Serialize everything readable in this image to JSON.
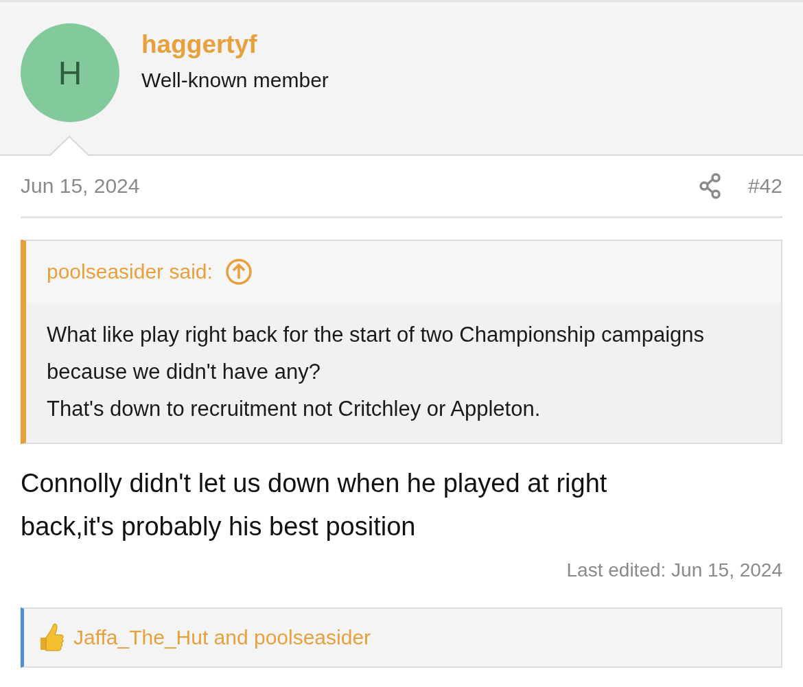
{
  "user": {
    "initial": "H",
    "name": "haggertyf",
    "title": "Well-known member"
  },
  "post": {
    "date": "Jun 15, 2024",
    "number": "#42",
    "quote": {
      "author": "poolseasider said:",
      "lines": [
        "What like play right back for the start of two Championship campaigns because we didn't have any?",
        "That's down to recruitment not Critchley or Appleton."
      ]
    },
    "message": "Connolly didn't let us down when he played at right back,it's probably his best position",
    "last_edited": "Last edited: Jun 15, 2024",
    "reactions": "Jaffa_The_Hut and poolseasider"
  }
}
